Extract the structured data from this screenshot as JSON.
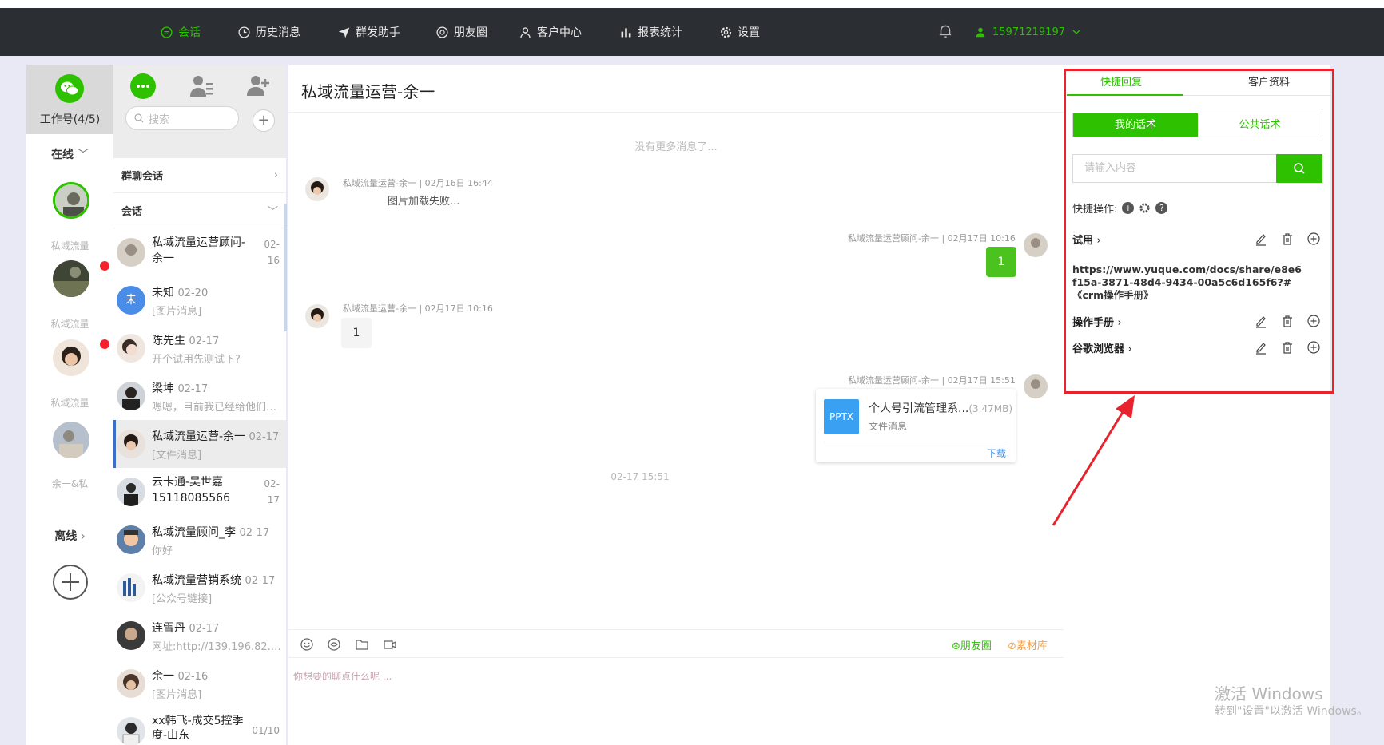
{
  "nav": {
    "items": [
      {
        "label": "会话",
        "icon": "chat-icon",
        "active": true
      },
      {
        "label": "历史消息",
        "icon": "clock-icon",
        "active": false
      },
      {
        "label": "群发助手",
        "icon": "send-icon",
        "active": false
      },
      {
        "label": "朋友圈",
        "icon": "aperture-icon",
        "active": false
      },
      {
        "label": "客户中心",
        "icon": "user-icon",
        "active": false
      },
      {
        "label": "报表统计",
        "icon": "bar-chart-icon",
        "active": false
      },
      {
        "label": "设置",
        "icon": "gear-icon",
        "active": false
      }
    ],
    "phone": "15971219197"
  },
  "accounts": {
    "header_label": "工作号(4/5)",
    "online_label": "在线",
    "offline_label": "离线",
    "names": [
      "私域流量",
      "私域流量",
      "私域流量",
      "余一&私"
    ]
  },
  "list": {
    "search_placeholder": "搜索",
    "group_label": "群聊会话",
    "session_label": "会话",
    "rows": [
      {
        "name": "私域流量运营顾问-余一",
        "date_a": "02-",
        "date_b": "16",
        "preview": ""
      },
      {
        "name": "未知",
        "date": "02-20",
        "preview": "[图片消息]"
      },
      {
        "name": "陈先生",
        "date": "02-17",
        "preview": "开个试用先测试下?"
      },
      {
        "name": "梁坤",
        "date": "02-17",
        "preview": "嗯嗯，目前我已经给他们买..."
      },
      {
        "name": "私域流量运营-余一",
        "date": "02-17",
        "preview": "[文件消息]"
      },
      {
        "name": "云卡通-吴世嘉 15118085566",
        "date_a": "02-",
        "date_b": "17",
        "preview": ""
      },
      {
        "name": "私域流量顾问_李",
        "date": "02-17",
        "preview": "你好"
      },
      {
        "name": "私域流量营销系统",
        "date": "02-17",
        "preview": "[公众号链接]"
      },
      {
        "name": "连雪丹",
        "date": "02-17",
        "preview": "网址:http://139.196.82.82/a..."
      },
      {
        "name": "余一",
        "date": "02-16",
        "preview": "[图片消息]"
      },
      {
        "name": "xx韩飞-成交5控季度-山东",
        "date": "01/10",
        "preview": ""
      }
    ],
    "unknown_avatar_char": "未"
  },
  "chat": {
    "title": "私域流量运营-余一",
    "no_more": "没有更多消息了...",
    "messages": [
      {
        "meta": "私域流量运营-余一 | 02月16日 16:44",
        "text": "图片加载失败..."
      },
      {
        "meta": "私域流量运营顾问-余一 | 02月17日 10:16",
        "text": "1"
      },
      {
        "meta": "私域流量运营-余一 | 02月17日 10:16",
        "text": "1"
      },
      {
        "meta": "私域流量运营顾问-余一 | 02月17日 15:51",
        "text": ""
      }
    ],
    "file": {
      "icon_label": "PPTX",
      "name": "个人号引流管理系...",
      "size": "(3.47MB)",
      "sub": "文件消息",
      "download": "下载"
    },
    "timestamp": "02-17 15:51",
    "moments_link": "朋友圈",
    "materials_link": "素材库",
    "compose_placeholder": "你想要的聊点什么呢 ..."
  },
  "right": {
    "tab_quick": "快捷回复",
    "tab_profile": "客户资料",
    "seg_mine": "我的话术",
    "seg_public": "公共话术",
    "input_placeholder": "请输入内容",
    "quick_ops": "快捷操作:",
    "groups": [
      "试用",
      "操作手册",
      "谷歌浏览器"
    ],
    "link_text": "https://www.yuque.com/docs/share/e8e6f15a-3871-48d4-9434-00a5c6d165f6?# 《crm操作手册》"
  },
  "watermark": {
    "line1": "激活 Windows",
    "line2": "转到\"设置\"以激活 Windows。"
  },
  "colors": {
    "accent": "#2dc100",
    "topbar": "#2b2f33",
    "highlight_box": "#e8232d",
    "file_icon": "#3aa0f2"
  }
}
